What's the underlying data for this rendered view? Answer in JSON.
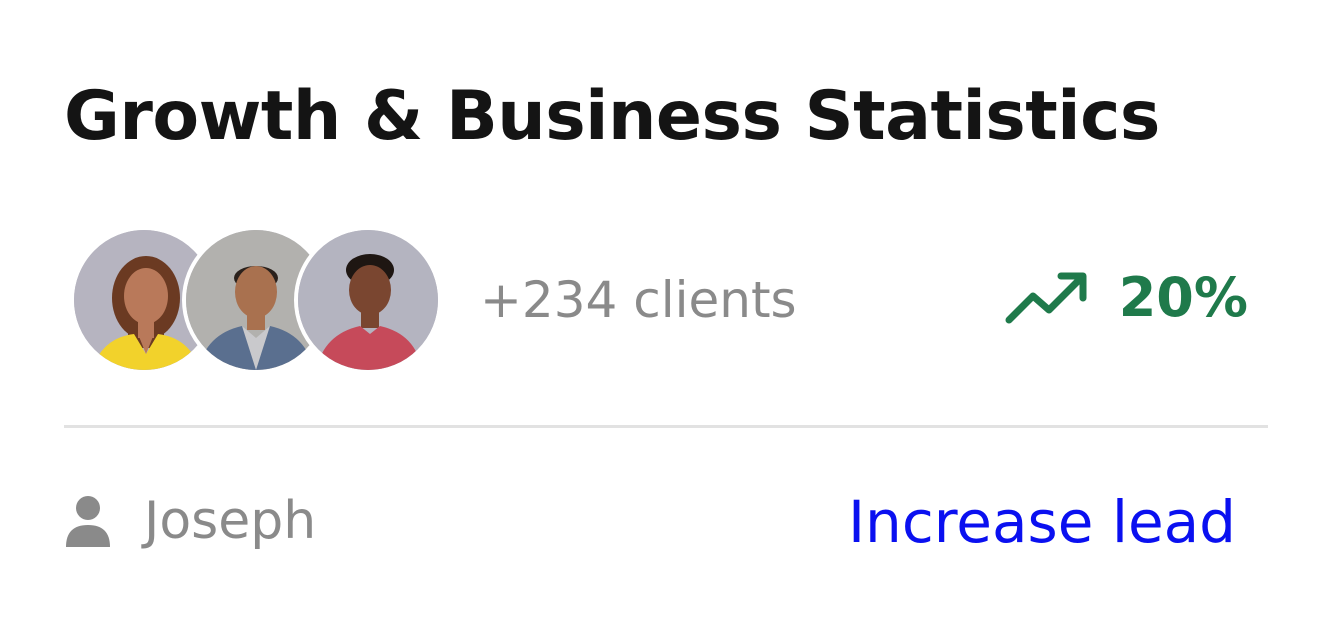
{
  "card": {
    "title": "Growth & Business Statistics"
  },
  "stats": {
    "avatars": [
      {
        "icon": "avatar-woman-yellow-top"
      },
      {
        "icon": "avatar-man-blue-blazer"
      },
      {
        "icon": "avatar-man-red-shirt"
      }
    ],
    "clients_label": "+234 clients",
    "growth_icon": "trending-up-icon",
    "growth_value": "20%"
  },
  "footer": {
    "user_icon": "user-icon",
    "user_name": "Joseph",
    "action_label": "Increase lead"
  },
  "colors": {
    "title": "#141414",
    "muted_text": "#8a8a8a",
    "growth": "#1f7a4b",
    "link": "#0a10f0",
    "divider": "#e2e2e2"
  }
}
